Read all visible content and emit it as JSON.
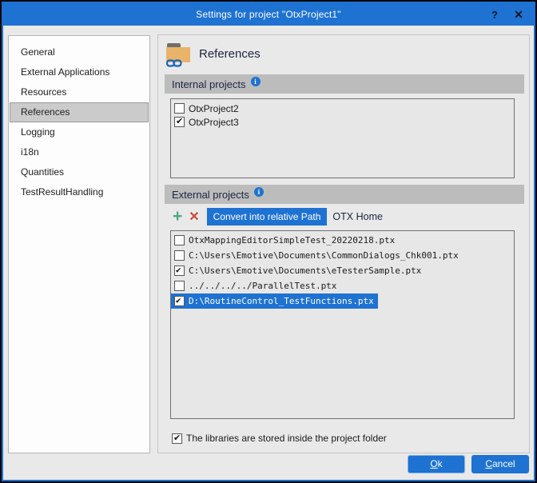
{
  "window": {
    "title": "Settings for project \"OtxProject1\"",
    "help_label": "?",
    "close_label": "✕"
  },
  "colors": {
    "accent_blue": "#1e72d2",
    "section_header_gray": "#bcbcbc",
    "dialog_bg": "#e9e9e9",
    "selection_blue": "#1e72d2",
    "plus_green": "#51a77e",
    "delete_red": "#c8493c",
    "folder_orange": "#e9b369"
  },
  "sidebar": {
    "items": [
      {
        "label": "General",
        "selected": false
      },
      {
        "label": "External Applications",
        "selected": false
      },
      {
        "label": "Resources",
        "selected": false
      },
      {
        "label": "References",
        "selected": true
      },
      {
        "label": "Logging",
        "selected": false
      },
      {
        "label": "i18n",
        "selected": false
      },
      {
        "label": "Quantities",
        "selected": false
      },
      {
        "label": "TestResultHandling",
        "selected": false
      }
    ]
  },
  "main": {
    "page_title": "References",
    "page_icon": "folder-references-icon",
    "internal": {
      "header": "Internal projects",
      "info_icon": "i",
      "items": [
        {
          "label": "OtxProject2",
          "checked": false,
          "selected": false
        },
        {
          "label": "OtxProject3",
          "checked": true,
          "selected": false
        }
      ]
    },
    "external": {
      "header": "External projects",
      "info_icon": "i",
      "toolbar": {
        "add_icon": "+",
        "delete_icon": "✕",
        "convert_label": "Convert into relative Path",
        "otx_home_label": "OTX Home"
      },
      "items": [
        {
          "label": "OtxMappingEditorSimpleTest_20220218.ptx",
          "checked": false,
          "selected": false
        },
        {
          "label": "C:\\Users\\Emotive\\Documents\\CommonDialogs_Chk001.ptx",
          "checked": false,
          "selected": false
        },
        {
          "label": "C:\\Users\\Emotive\\Documents\\eTesterSample.ptx",
          "checked": true,
          "selected": false
        },
        {
          "label": "../../../../ParallelTest.ptx",
          "checked": false,
          "selected": false
        },
        {
          "label": "D:\\RoutineControl_TestFunctions.ptx",
          "checked": true,
          "selected": true
        }
      ]
    },
    "footer_checkbox": {
      "label": "The libraries are stored inside the project folder",
      "checked": true
    }
  },
  "buttons": {
    "ok_label": "Ok",
    "cancel_label": "Cancel"
  }
}
